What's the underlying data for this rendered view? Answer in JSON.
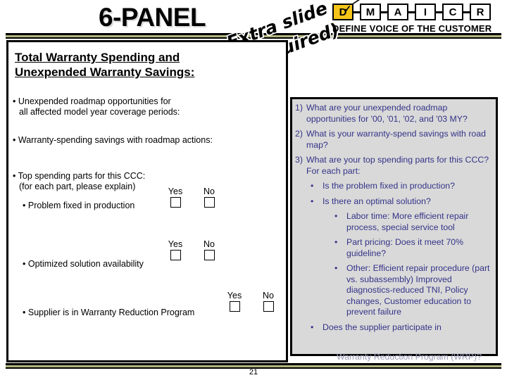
{
  "slide": {
    "title": "6-PANEL",
    "page_number": "21",
    "stamp": {
      "line1": "Extra slide",
      "line2": "(if required)"
    }
  },
  "dmaic": {
    "phases": [
      {
        "letter": "D",
        "active": true
      },
      {
        "letter": "M",
        "active": false
      },
      {
        "letter": "A",
        "active": false
      },
      {
        "letter": "I",
        "active": false
      },
      {
        "letter": "C",
        "active": false
      },
      {
        "letter": "R",
        "active": false
      }
    ],
    "active_check": "✓",
    "subtitle": "DEFINE VOICE OF THE CUSTOMER",
    "active_color": "#f5c518"
  },
  "left_panel": {
    "heading_line1": "Total Warranty Spending and",
    "heading_line2": "Unexpended Warranty Savings:",
    "bullets": [
      {
        "marker": "•",
        "line1": "Unexpended roadmap opportunities for",
        "line2": "all affected model year coverage periods:"
      },
      {
        "marker": "•",
        "line1": "Warranty-spending savings with roadmap actions:",
        "line2": ""
      },
      {
        "marker": "•",
        "line1": "Top spending parts for this CCC:",
        "line2": "(for each part, please explain)"
      },
      {
        "marker": "•",
        "line1": "Problem fixed in production",
        "line2": ""
      },
      {
        "marker": "•",
        "line1": "Optimized solution availability",
        "line2": ""
      },
      {
        "marker": "•",
        "line1": "Supplier is in Warranty Reduction Program",
        "line2": ""
      }
    ],
    "checkbox_groups": [
      {
        "yes_label": "Yes",
        "no_label": "No",
        "yes_checked": false,
        "no_checked": false
      },
      {
        "yes_label": "Yes",
        "no_label": "No",
        "yes_checked": false,
        "no_checked": false
      },
      {
        "yes_label": "Yes",
        "no_label": "No",
        "yes_checked": false,
        "no_checked": false
      }
    ]
  },
  "right_panel": {
    "background_color": "#d9d9d9",
    "text_color": "#333388",
    "items": [
      {
        "level": 0,
        "marker": "1)",
        "text": "What are your unexpended roadmap opportunities for '00, '01, '02, and  '03 MY?"
      },
      {
        "level": 0,
        "marker": "2)",
        "text": "What is your warranty-spend savings with road map?"
      },
      {
        "level": 0,
        "marker": "3)",
        "text": "What are your top spending parts for this CCC? For each part:"
      },
      {
        "level": 1,
        "marker": "•",
        "text": "Is the problem fixed in production?"
      },
      {
        "level": 1,
        "marker": "•",
        "text": "Is there an optimal solution?"
      },
      {
        "level": 2,
        "marker": "•",
        "text": "Labor time: More efficient repair process, special service tool"
      },
      {
        "level": 2,
        "marker": "•",
        "text": "Part pricing: Does it meet 70% guideline?"
      },
      {
        "level": 2,
        "marker": "•",
        "text": "Other: Efficient repair procedure (part vs. subassembly) Improved diagnostics-reduced TNI, Policy changes, Customer education to prevent failure"
      },
      {
        "level": 1,
        "marker": "•",
        "text": "Does the supplier participate in"
      }
    ],
    "overflow_text": "Warranty Reduction Program (WRP)?"
  }
}
